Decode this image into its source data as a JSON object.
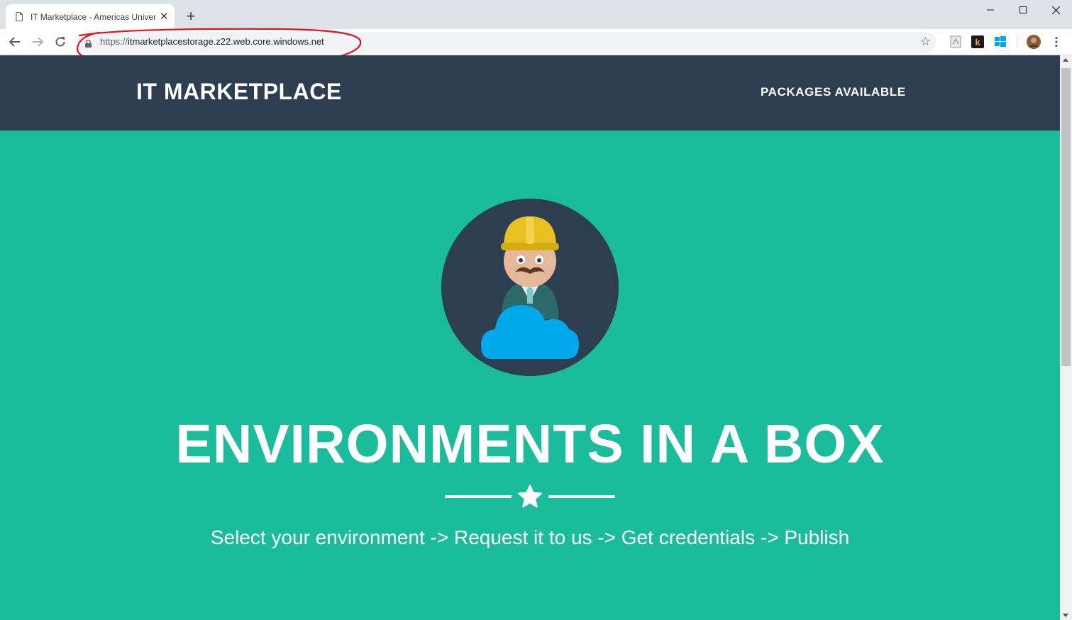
{
  "browser": {
    "tab": {
      "title": "IT Marketplace - Americas University",
      "close_icon": "✕"
    },
    "new_tab_icon": "+",
    "window_controls": {
      "minimize": "—",
      "maximize": "☐",
      "close": "✕"
    },
    "address_bar": {
      "scheme": "https://",
      "domain": "itmarketplacestorage.z22.web.core.windows.net"
    },
    "annotation_color": "#e0141e"
  },
  "site": {
    "brand": "IT MARKETPLACE",
    "nav": {
      "packages_link": "PACKAGES AVAILABLE"
    },
    "hero": {
      "headline": "ENVIRONMENTS IN A BOX",
      "tagline": "Select your environment -> Request it to us -> Get credentials -> Publish",
      "avatar_icon": "construction-worker-cloud-icon"
    }
  },
  "colors": {
    "navbar": "#2c3e50",
    "masthead": "#1abc9c",
    "text": "#ffffff"
  }
}
